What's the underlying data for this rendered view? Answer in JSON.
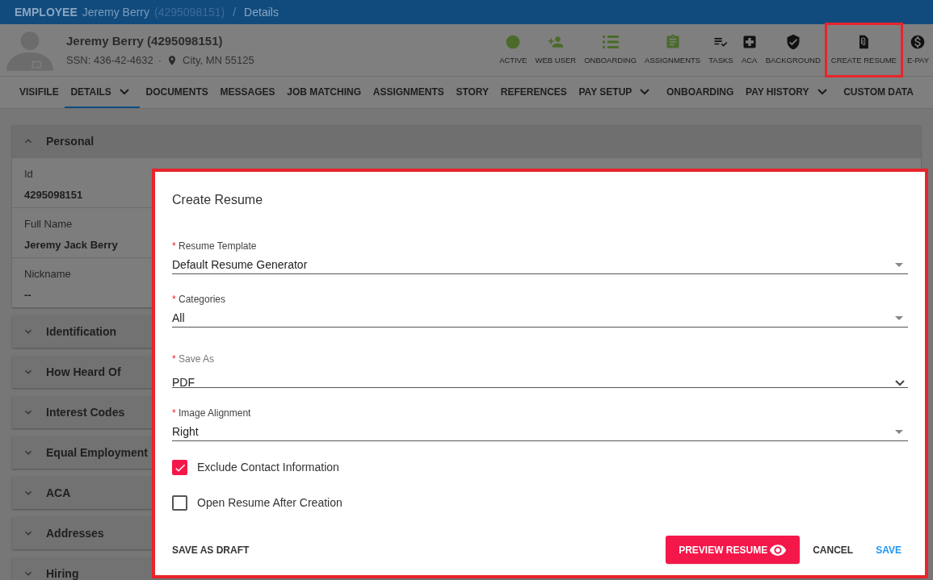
{
  "breadcrumb": {
    "section": "EMPLOYEE",
    "name": "Jeremy Berry",
    "id": "(4295098151)",
    "separator": "/",
    "page": "Details"
  },
  "profile": {
    "name": "Jeremy Berry (4295098151)",
    "ssn": "SSN: 436-42-4632",
    "dot": "·",
    "location": "City, MN 55125"
  },
  "toolbar": [
    {
      "label": "ACTIVE",
      "color": "#4a6b2a",
      "highlighted": false
    },
    {
      "label": "WEB USER",
      "color": "#4a6b2a",
      "highlighted": false
    },
    {
      "label": "ONBOARDING",
      "color": "#4a6b2a",
      "highlighted": false
    },
    {
      "label": "ASSIGNMENTS",
      "color": "#4a6b2a",
      "highlighted": false
    },
    {
      "label": "TASKS",
      "color": "#111111",
      "highlighted": false
    },
    {
      "label": "ACA",
      "color": "#111111",
      "highlighted": false
    },
    {
      "label": "BACKGROUND",
      "color": "#111111",
      "highlighted": false
    },
    {
      "label": "CREATE RESUME",
      "color": "#111111",
      "highlighted": true
    },
    {
      "label": "E-PAY",
      "color": "#111111",
      "highlighted": false
    }
  ],
  "tabs": [
    {
      "label": "VISIFILE",
      "selected": false,
      "dropdown": false
    },
    {
      "label": "DETAILS",
      "selected": true,
      "dropdown": true
    },
    {
      "label": "DOCUMENTS",
      "selected": false,
      "dropdown": false
    },
    {
      "label": "MESSAGES",
      "selected": false,
      "dropdown": false
    },
    {
      "label": "JOB MATCHING",
      "selected": false,
      "dropdown": false
    },
    {
      "label": "ASSIGNMENTS",
      "selected": false,
      "dropdown": false
    },
    {
      "label": "STORY",
      "selected": false,
      "dropdown": false
    },
    {
      "label": "REFERENCES",
      "selected": false,
      "dropdown": false
    },
    {
      "label": "PAY SETUP",
      "selected": false,
      "dropdown": true
    },
    {
      "label": "ONBOARDING",
      "selected": false,
      "dropdown": false
    },
    {
      "label": "PAY HISTORY",
      "selected": false,
      "dropdown": true
    },
    {
      "label": "CUSTOM DATA",
      "selected": false,
      "dropdown": false
    }
  ],
  "sections": [
    {
      "title": "Personal",
      "expanded": true,
      "fields": [
        {
          "label": "Id",
          "value": "4295098151"
        },
        {
          "label": "Full Name",
          "value": "Jeremy Jack Berry"
        },
        {
          "label": "Nickname",
          "value": "--"
        }
      ]
    },
    {
      "title": "Identification",
      "expanded": false
    },
    {
      "title": "How Heard Of",
      "expanded": false
    },
    {
      "title": "Interest Codes",
      "expanded": false
    },
    {
      "title": "Equal Employment",
      "expanded": false
    },
    {
      "title": "ACA",
      "expanded": false
    },
    {
      "title": "Addresses",
      "expanded": false
    },
    {
      "title": "Hiring",
      "expanded": false
    }
  ],
  "dialog": {
    "title": "Create Resume",
    "highlighted": true,
    "fields": [
      {
        "label": "Resume Template",
        "value": "Default Resume Generator",
        "required": "*",
        "kind": "caret"
      },
      {
        "label": "Categories",
        "value": "All",
        "required": "*",
        "kind": "caret"
      },
      {
        "label": "Save As",
        "value": "PDF",
        "required": "*",
        "kind": "chevron"
      },
      {
        "label": "Image Alignment",
        "value": "Right",
        "required": "*",
        "kind": "caret"
      }
    ],
    "checkboxes": [
      {
        "label": "Exclude Contact Information",
        "checked": true
      },
      {
        "label": "Open Resume After Creation",
        "checked": false
      }
    ],
    "buttons": [
      {
        "label": "SAVE AS DRAFT",
        "kind": "text"
      },
      {
        "label": "PREVIEW RESUME",
        "kind": "primary"
      },
      {
        "label": "CANCEL",
        "kind": "text"
      },
      {
        "label": "SAVE",
        "kind": "link"
      }
    ]
  }
}
